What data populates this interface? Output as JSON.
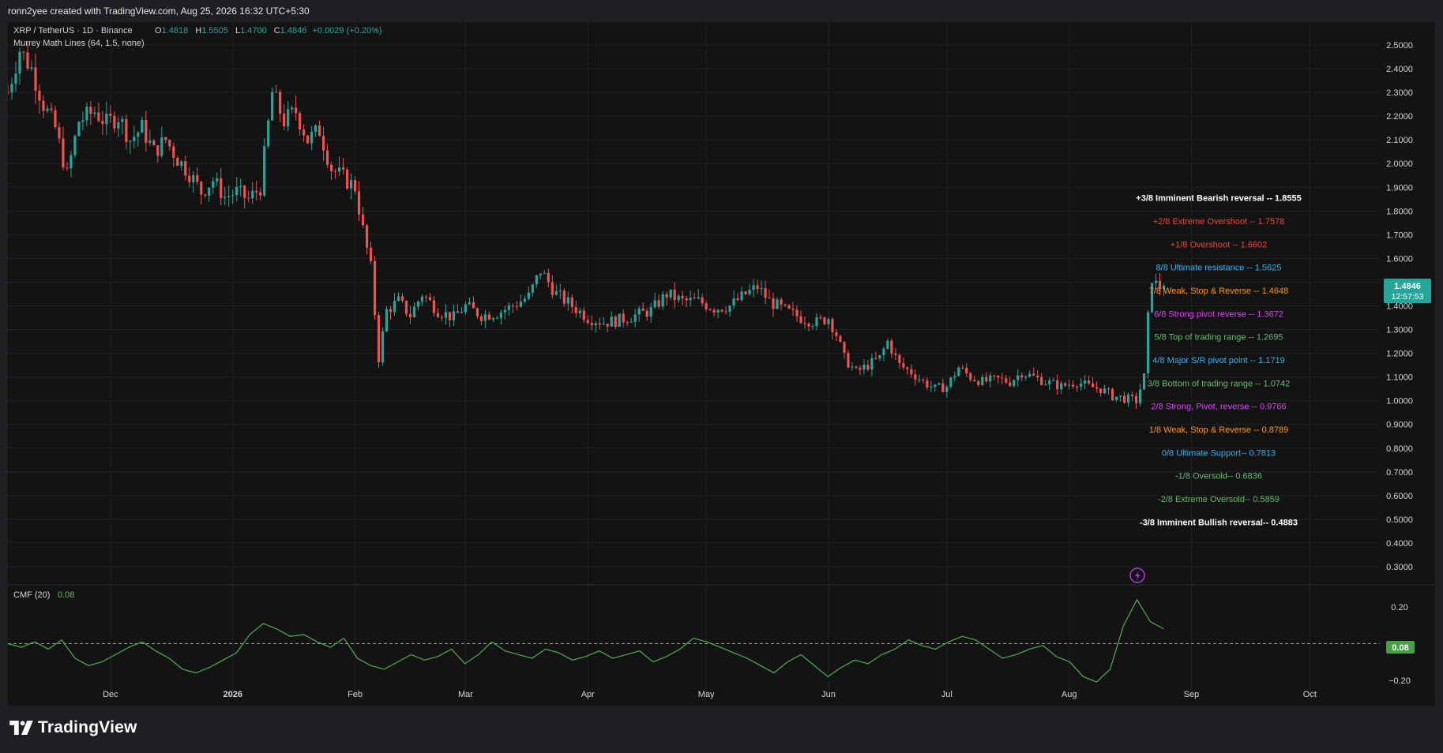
{
  "header": {
    "credit": "ronn2yee created with TradingView.com, Aug 25, 2026 16:32 UTC+5:30"
  },
  "legend": {
    "symbol": "XRP / TetherUS · 1D · Binance",
    "o_label": "O",
    "o_value": "1.4818",
    "h_label": "H",
    "h_value": "1.5505",
    "l_label": "L",
    "l_value": "1.4700",
    "c_label": "C",
    "c_value": "1.4846",
    "change": "+0.0029 (+0.20%)",
    "indicator": "Murrey Math Lines (64, 1.5, none)"
  },
  "cmf": {
    "label": "CMF (20)",
    "value": "0.08"
  },
  "price_tag": {
    "value": "1.4846",
    "countdown": "12:57:53"
  },
  "brand": {
    "name": "TradingView"
  },
  "colors": {
    "up": "#26a69a",
    "down": "#ef5350",
    "background": "#131313",
    "cmf_line": "#4caf50"
  },
  "chart_data": {
    "type": "candlestick",
    "symbol": "XRP / TetherUS",
    "timeframe": "1D",
    "y_axis": {
      "ticks": [
        "2.5000",
        "2.4000",
        "2.3000",
        "2.2000",
        "2.1000",
        "2.0000",
        "1.9000",
        "1.8000",
        "1.7000",
        "1.6000",
        "1.5000",
        "1.4000",
        "1.3000",
        "1.2000",
        "1.1000",
        "1.0000",
        "0.9000",
        "0.8000",
        "0.7000",
        "0.6000",
        "0.5000",
        "0.4000",
        "0.3000"
      ],
      "range": [
        0.25,
        2.58
      ]
    },
    "x_axis": {
      "ticks": [
        "Dec",
        "2026",
        "Feb",
        "Mar",
        "Apr",
        "May",
        "Jun",
        "Jul",
        "Aug",
        "Sep",
        "Oct"
      ]
    },
    "price_path": [
      [
        "11-05",
        2.3
      ],
      [
        "11-08",
        2.48
      ],
      [
        "11-11",
        2.4
      ],
      [
        "11-14",
        2.25
      ],
      [
        "11-17",
        2.15
      ],
      [
        "11-20",
        1.95
      ],
      [
        "11-23",
        2.18
      ],
      [
        "11-27",
        2.22
      ],
      [
        "11-30",
        2.17
      ],
      [
        "12-03",
        2.2
      ],
      [
        "12-06",
        2.1
      ],
      [
        "12-09",
        2.15
      ],
      [
        "12-12",
        2.05
      ],
      [
        "12-15",
        2.1
      ],
      [
        "12-18",
        2.02
      ],
      [
        "12-21",
        1.96
      ],
      [
        "12-24",
        1.88
      ],
      [
        "12-27",
        1.93
      ],
      [
        "12-30",
        1.86
      ],
      [
        "01-02",
        1.88
      ],
      [
        "01-05",
        1.85
      ],
      [
        "01-08",
        1.9
      ],
      [
        "01-11",
        2.3
      ],
      [
        "01-14",
        2.18
      ],
      [
        "01-17",
        2.22
      ],
      [
        "01-20",
        2.1
      ],
      [
        "01-23",
        2.14
      ],
      [
        "01-26",
        1.98
      ],
      [
        "01-29",
        1.94
      ],
      [
        "02-01",
        1.9
      ],
      [
        "02-03",
        1.72
      ],
      [
        "02-05",
        1.56
      ],
      [
        "02-07",
        1.18
      ],
      [
        "02-09",
        1.38
      ],
      [
        "02-12",
        1.42
      ],
      [
        "02-15",
        1.36
      ],
      [
        "02-18",
        1.45
      ],
      [
        "02-22",
        1.38
      ],
      [
        "02-26",
        1.35
      ],
      [
        "03-01",
        1.4
      ],
      [
        "03-05",
        1.36
      ],
      [
        "03-09",
        1.37
      ],
      [
        "03-13",
        1.4
      ],
      [
        "03-17",
        1.44
      ],
      [
        "03-20",
        1.55
      ],
      [
        "03-24",
        1.45
      ],
      [
        "03-28",
        1.4
      ],
      [
        "04-01",
        1.35
      ],
      [
        "04-05",
        1.33
      ],
      [
        "04-09",
        1.34
      ],
      [
        "04-13",
        1.36
      ],
      [
        "04-17",
        1.38
      ],
      [
        "04-21",
        1.45
      ],
      [
        "04-25",
        1.42
      ],
      [
        "04-29",
        1.42
      ],
      [
        "05-03",
        1.39
      ],
      [
        "05-07",
        1.4
      ],
      [
        "05-11",
        1.45
      ],
      [
        "05-14",
        1.48
      ],
      [
        "05-17",
        1.42
      ],
      [
        "05-21",
        1.38
      ],
      [
        "05-25",
        1.35
      ],
      [
        "05-29",
        1.33
      ],
      [
        "06-01",
        1.35
      ],
      [
        "06-03",
        1.28
      ],
      [
        "06-05",
        1.18
      ],
      [
        "06-08",
        1.12
      ],
      [
        "06-11",
        1.15
      ],
      [
        "06-14",
        1.18
      ],
      [
        "06-16",
        1.25
      ],
      [
        "06-19",
        1.15
      ],
      [
        "06-22",
        1.12
      ],
      [
        "06-25",
        1.08
      ],
      [
        "06-28",
        1.05
      ],
      [
        "07-01",
        1.06
      ],
      [
        "07-04",
        1.14
      ],
      [
        "07-07",
        1.1
      ],
      [
        "07-10",
        1.08
      ],
      [
        "07-14",
        1.09
      ],
      [
        "07-17",
        1.08
      ],
      [
        "07-20",
        1.12
      ],
      [
        "07-23",
        1.1
      ],
      [
        "07-26",
        1.08
      ],
      [
        "07-30",
        1.06
      ],
      [
        "08-03",
        1.08
      ],
      [
        "08-06",
        1.06
      ],
      [
        "08-09",
        1.05
      ],
      [
        "08-12",
        1.02
      ],
      [
        "08-15",
        1.01
      ],
      [
        "08-18",
        1.0
      ],
      [
        "08-20",
        1.1
      ],
      [
        "08-21",
        1.35
      ],
      [
        "08-22",
        1.52
      ],
      [
        "08-23",
        1.49
      ],
      [
        "08-24",
        1.48
      ],
      [
        "08-25",
        1.4846
      ]
    ],
    "murrey_levels": [
      {
        "label": "+3/8 Imminent Bearish reversal --  1.8555",
        "value": 1.8555,
        "color": "#ffffff"
      },
      {
        "label": "+2/8 Extreme Overshoot --  1.7578",
        "value": 1.7578,
        "color": "#f44336"
      },
      {
        "label": "+1/8 Overshoot --  1.6602",
        "value": 1.6602,
        "color": "#f44336"
      },
      {
        "label": "8/8 Ultimate resistance --  1.5625",
        "value": 1.5625,
        "color": "#29b6f6"
      },
      {
        "label": "7/8 Weak, Stop & Reverse --  1.4648",
        "value": 1.4648,
        "color": "#ff9800"
      },
      {
        "label": "6/8 Strong pivot reverse --  1.3672",
        "value": 1.3672,
        "color": "#e040fb"
      },
      {
        "label": "5/8 Top of trading range --  1.2695",
        "value": 1.2695,
        "color": "#66bb6a"
      },
      {
        "label": "4/8 Major S/R pivot point --  1.1719",
        "value": 1.1719,
        "color": "#29b6f6"
      },
      {
        "label": "3/8 Bottom of trading range --  1.0742",
        "value": 1.0742,
        "color": "#66bb6a"
      },
      {
        "label": "2/8 Strong, Pivot, reverse --  0.9766",
        "value": 0.9766,
        "color": "#e040fb"
      },
      {
        "label": "1/8 Weak, Stop & Reverse --  0.8789",
        "value": 0.8789,
        "color": "#ff9800"
      },
      {
        "label": "0/8 Ultimate Support--  0.7813",
        "value": 0.7813,
        "color": "#29b6f6"
      },
      {
        "label": "-1/8 Oversold--  0.6836",
        "value": 0.6836,
        "color": "#66bb6a"
      },
      {
        "label": "-2/8 Extreme Oversold--  0.5859",
        "value": 0.5859,
        "color": "#66bb6a"
      },
      {
        "label": "-3/8 Imminent Bullish reversal--  0.4883",
        "value": 0.4883,
        "color": "#ffffff"
      }
    ],
    "cmf": {
      "name": "CMF (20)",
      "last": 0.08,
      "y_ticks": [
        "0.20",
        "0.00",
        "−0.20"
      ],
      "range": [
        -0.27,
        0.3
      ],
      "values": [
        0.0,
        -0.02,
        0.01,
        -0.03,
        0.02,
        -0.08,
        -0.12,
        -0.1,
        -0.06,
        -0.02,
        0.01,
        -0.04,
        -0.08,
        -0.14,
        -0.16,
        -0.13,
        -0.09,
        -0.05,
        0.05,
        0.11,
        0.08,
        0.04,
        0.05,
        0.01,
        -0.02,
        0.03,
        -0.08,
        -0.12,
        -0.14,
        -0.1,
        -0.06,
        -0.09,
        -0.07,
        -0.03,
        -0.11,
        -0.06,
        0.01,
        -0.04,
        -0.06,
        -0.08,
        -0.03,
        -0.05,
        -0.09,
        -0.07,
        -0.04,
        -0.08,
        -0.06,
        -0.04,
        -0.1,
        -0.07,
        -0.03,
        0.03,
        0.01,
        -0.02,
        -0.05,
        -0.08,
        -0.12,
        -0.16,
        -0.1,
        -0.06,
        -0.12,
        -0.18,
        -0.13,
        -0.09,
        -0.11,
        -0.06,
        -0.03,
        0.02,
        -0.01,
        -0.03,
        0.01,
        0.04,
        0.02,
        -0.03,
        -0.08,
        -0.06,
        -0.03,
        -0.01,
        -0.07,
        -0.1,
        -0.18,
        -0.21,
        -0.14,
        0.1,
        0.24,
        0.12,
        0.08
      ],
      "color": "#4caf50"
    }
  }
}
